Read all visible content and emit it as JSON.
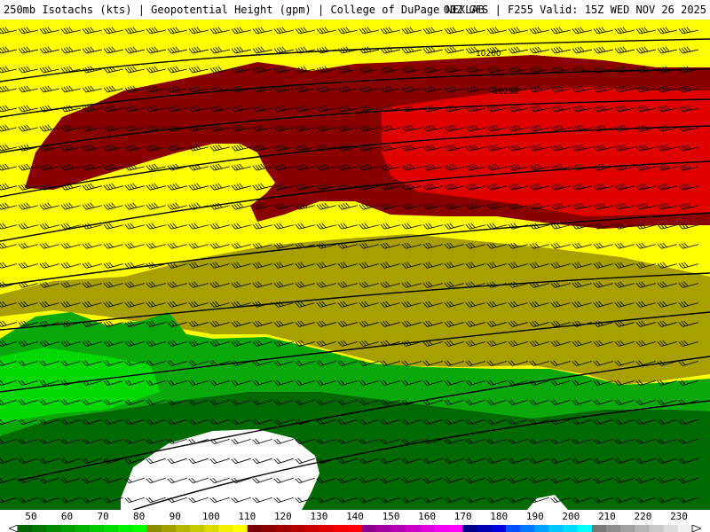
{
  "header": {
    "left": "250mb Isotachs (kts) | Geopotential Height (gpm) | College of DuPage NEXLAB",
    "right": "00Z GFS | F255 Valid: 15Z WED NOV 26 2025"
  },
  "map": {
    "contour_labels": [
      "10200",
      "10260"
    ],
    "colors": {
      "white": "#ffffff",
      "green_dark": "#006a00",
      "green_mid": "#0aa80a",
      "green_bright": "#00ff00",
      "olive": "#a8a000",
      "yellow": "#ffff00",
      "red_dark": "#8a0000",
      "red": "#e00000"
    }
  },
  "legend": {
    "labels": [
      "50",
      "60",
      "70",
      "80",
      "90",
      "100",
      "110",
      "120",
      "130",
      "140",
      "150",
      "160",
      "170",
      "180",
      "190",
      "200",
      "210",
      "220",
      "230"
    ],
    "colors": [
      "#006400",
      "#007800",
      "#008c00",
      "#00a000",
      "#00b400",
      "#00c800",
      "#00dc00",
      "#00f000",
      "#00ff00",
      "#8c8c00",
      "#a0a000",
      "#b4b400",
      "#c8c800",
      "#dcdc00",
      "#f0f000",
      "#ffff00",
      "#780000",
      "#8c0000",
      "#a00000",
      "#b40000",
      "#c80000",
      "#dc0000",
      "#f00000",
      "#ff0000",
      "#8c008c",
      "#a000a0",
      "#b400b4",
      "#c800c8",
      "#dc00dc",
      "#f000f0",
      "#ff00ff",
      "#00008c",
      "#0000b4",
      "#0000dc",
      "#0050ff",
      "#0078ff",
      "#00a0ff",
      "#00c8ff",
      "#00dcff",
      "#00ffff",
      "#787878",
      "#8c8c8c",
      "#a0a0a0",
      "#b4b4b4",
      "#c8c8c8",
      "#dcdcdc",
      "#f0f0f0"
    ]
  }
}
